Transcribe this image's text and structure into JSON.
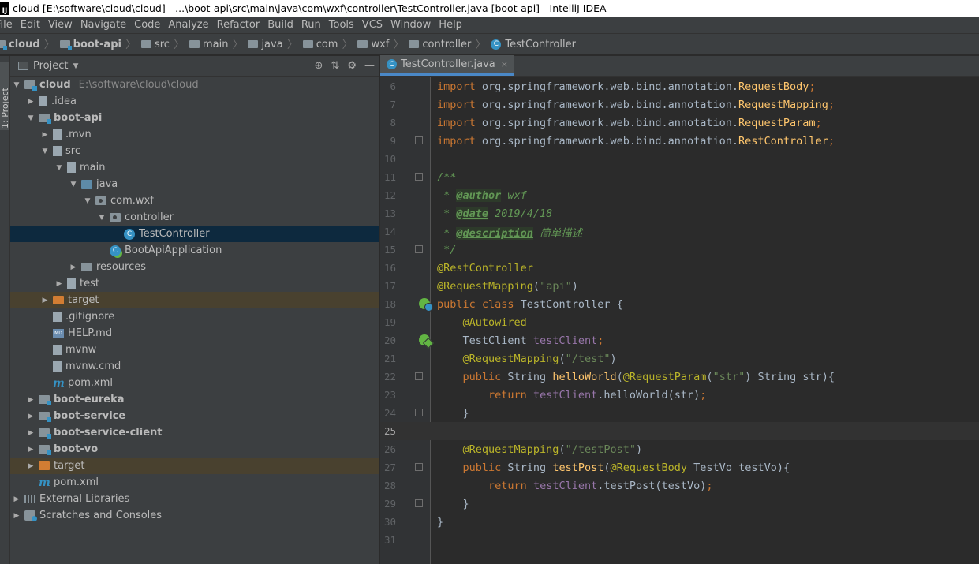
{
  "window": {
    "title": "cloud [E:\\software\\cloud\\cloud] - ...\\boot-api\\src\\main\\java\\com\\wxf\\controller\\TestController.java [boot-api] - IntelliJ IDEA",
    "app_icon": "IJ"
  },
  "menu": [
    "File",
    "Edit",
    "View",
    "Navigate",
    "Code",
    "Analyze",
    "Refactor",
    "Build",
    "Run",
    "Tools",
    "VCS",
    "Window",
    "Help"
  ],
  "breadcrumbs": [
    {
      "label": "cloud",
      "bold": true,
      "icon": "module-folder-icon"
    },
    {
      "label": "boot-api",
      "bold": true,
      "icon": "module-folder-icon"
    },
    {
      "label": "src",
      "icon": "folder-icon"
    },
    {
      "label": "main",
      "icon": "folder-icon"
    },
    {
      "label": "java",
      "icon": "source-folder-icon"
    },
    {
      "label": "com",
      "icon": "package-icon"
    },
    {
      "label": "wxf",
      "icon": "package-icon"
    },
    {
      "label": "controller",
      "icon": "package-icon"
    },
    {
      "label": "TestController",
      "icon": "class-icon"
    }
  ],
  "sidebar_tab": "1: Project",
  "project_panel": {
    "title": "Project",
    "tree": [
      {
        "label": "cloud",
        "path": "E:\\software\\cloud\\cloud",
        "depth": 0,
        "expanded": true,
        "bold": true,
        "icon": "module-folder-icon"
      },
      {
        "label": ".idea",
        "depth": 1,
        "expanded": false,
        "icon": "folder-icon"
      },
      {
        "label": "boot-api",
        "depth": 1,
        "expanded": true,
        "bold": true,
        "icon": "module-folder-icon"
      },
      {
        "label": ".mvn",
        "depth": 2,
        "expanded": false,
        "icon": "folder-icon"
      },
      {
        "label": "src",
        "depth": 2,
        "expanded": true,
        "icon": "folder-icon"
      },
      {
        "label": "main",
        "depth": 3,
        "expanded": true,
        "icon": "folder-icon"
      },
      {
        "label": "java",
        "depth": 4,
        "expanded": true,
        "icon": "source-folder-icon"
      },
      {
        "label": "com.wxf",
        "depth": 5,
        "expanded": true,
        "icon": "package-icon"
      },
      {
        "label": "controller",
        "depth": 6,
        "expanded": true,
        "icon": "package-icon"
      },
      {
        "label": "TestController",
        "depth": 7,
        "selected": true,
        "icon": "class-icon"
      },
      {
        "label": "BootApiApplication",
        "depth": 6,
        "icon": "spring-boot-class-icon"
      },
      {
        "label": "resources",
        "depth": 4,
        "expanded": false,
        "icon": "resources-folder-icon"
      },
      {
        "label": "test",
        "depth": 3,
        "expanded": false,
        "icon": "folder-icon"
      },
      {
        "label": "target",
        "depth": 2,
        "expanded": false,
        "excluded": true,
        "icon": "excluded-folder-icon"
      },
      {
        "label": ".gitignore",
        "depth": 2,
        "icon": "file-icon"
      },
      {
        "label": "HELP.md",
        "depth": 2,
        "icon": "markdown-file-icon"
      },
      {
        "label": "mvnw",
        "depth": 2,
        "icon": "file-icon"
      },
      {
        "label": "mvnw.cmd",
        "depth": 2,
        "icon": "file-icon"
      },
      {
        "label": "pom.xml",
        "depth": 2,
        "icon": "maven-icon"
      },
      {
        "label": "boot-eureka",
        "depth": 1,
        "expanded": false,
        "bold": true,
        "icon": "module-folder-icon"
      },
      {
        "label": "boot-service",
        "depth": 1,
        "expanded": false,
        "bold": true,
        "icon": "module-folder-icon"
      },
      {
        "label": "boot-service-client",
        "depth": 1,
        "expanded": false,
        "bold": true,
        "icon": "module-folder-icon"
      },
      {
        "label": "boot-vo",
        "depth": 1,
        "expanded": false,
        "bold": true,
        "icon": "module-folder-icon"
      },
      {
        "label": "target",
        "depth": 1,
        "expanded": false,
        "excluded": true,
        "icon": "excluded-folder-icon"
      },
      {
        "label": "pom.xml",
        "depth": 1,
        "icon": "maven-icon"
      },
      {
        "label": "External Libraries",
        "depth": 0,
        "expanded": false,
        "icon": "libraries-icon"
      },
      {
        "label": "Scratches and Consoles",
        "depth": 0,
        "expanded": false,
        "icon": "scratches-icon"
      }
    ]
  },
  "editor": {
    "tab": {
      "label": "TestController.java",
      "icon": "class-icon",
      "close": "×"
    },
    "current_line": 25,
    "lines": [
      {
        "n": 6,
        "tokens": [
          [
            "kw",
            "import"
          ],
          [
            "p",
            " org.springframework.web.bind.annotation."
          ],
          [
            "cls",
            "RequestBody"
          ],
          [
            "kw",
            ";"
          ]
        ]
      },
      {
        "n": 7,
        "tokens": [
          [
            "kw",
            "import"
          ],
          [
            "p",
            " org.springframework.web.bind.annotation."
          ],
          [
            "cls",
            "RequestMapping"
          ],
          [
            "kw",
            ";"
          ]
        ]
      },
      {
        "n": 8,
        "tokens": [
          [
            "kw",
            "import"
          ],
          [
            "p",
            " org.springframework.web.bind.annotation."
          ],
          [
            "cls",
            "RequestParam"
          ],
          [
            "kw",
            ";"
          ]
        ]
      },
      {
        "n": 9,
        "fold": true,
        "tokens": [
          [
            "kw",
            "import"
          ],
          [
            "p",
            " org.springframework.web.bind.annotation."
          ],
          [
            "cls",
            "RestController"
          ],
          [
            "kw",
            ";"
          ]
        ]
      },
      {
        "n": 10,
        "tokens": []
      },
      {
        "n": 11,
        "fold": true,
        "tokens": [
          [
            "doc",
            "/**"
          ]
        ]
      },
      {
        "n": 12,
        "tokens": [
          [
            "doc",
            " * "
          ],
          [
            "doctag",
            "@author"
          ],
          [
            "doc",
            " wxf"
          ]
        ]
      },
      {
        "n": 13,
        "tokens": [
          [
            "doc",
            " * "
          ],
          [
            "doctag",
            "@date"
          ],
          [
            "doc",
            " 2019/4/18"
          ]
        ]
      },
      {
        "n": 14,
        "tokens": [
          [
            "doc",
            " * "
          ],
          [
            "doctag",
            "@description"
          ],
          [
            "doc",
            " 简单描述"
          ]
        ]
      },
      {
        "n": 15,
        "fold": true,
        "tokens": [
          [
            "doc",
            " */"
          ]
        ]
      },
      {
        "n": 16,
        "tokens": [
          [
            "an",
            "@RestController"
          ]
        ]
      },
      {
        "n": 17,
        "tokens": [
          [
            "an",
            "@RequestMapping"
          ],
          [
            "p",
            "("
          ],
          [
            "str",
            "\"api\""
          ],
          [
            "p",
            ")"
          ]
        ]
      },
      {
        "n": 18,
        "gutter": "spring-bean-class-icon",
        "tokens": [
          [
            "kw",
            "public class "
          ],
          [
            "p",
            "TestController {"
          ]
        ]
      },
      {
        "n": 19,
        "tokens": [
          [
            "p",
            "    "
          ],
          [
            "an",
            "@Autowired"
          ]
        ]
      },
      {
        "n": 20,
        "gutter": "spring-autowired-icon",
        "tokens": [
          [
            "p",
            "    TestClient "
          ],
          [
            "fld",
            "testClient"
          ],
          [
            "kw",
            ";"
          ]
        ]
      },
      {
        "n": 21,
        "tokens": [
          [
            "p",
            "    "
          ],
          [
            "an",
            "@RequestMapping"
          ],
          [
            "p",
            "("
          ],
          [
            "str",
            "\"/test\""
          ],
          [
            "p",
            ")"
          ]
        ]
      },
      {
        "n": 22,
        "fold": true,
        "tokens": [
          [
            "p",
            "    "
          ],
          [
            "kw",
            "public "
          ],
          [
            "p",
            "String "
          ],
          [
            "fn",
            "helloWorld"
          ],
          [
            "p",
            "("
          ],
          [
            "an",
            "@RequestParam"
          ],
          [
            "p",
            "("
          ],
          [
            "str",
            "\"str\""
          ],
          [
            "p",
            ") String str){"
          ]
        ]
      },
      {
        "n": 23,
        "tokens": [
          [
            "p",
            "        "
          ],
          [
            "kw",
            "return "
          ],
          [
            "fld",
            "testClient"
          ],
          [
            "p",
            ".helloWorld(str)"
          ],
          [
            "kw",
            ";"
          ]
        ]
      },
      {
        "n": 24,
        "fold": true,
        "tokens": [
          [
            "p",
            "    }"
          ]
        ]
      },
      {
        "n": 25,
        "tokens": []
      },
      {
        "n": 26,
        "tokens": [
          [
            "p",
            "    "
          ],
          [
            "an",
            "@RequestMapping"
          ],
          [
            "p",
            "("
          ],
          [
            "str",
            "\"/testPost\""
          ],
          [
            "p",
            ")"
          ]
        ]
      },
      {
        "n": 27,
        "fold": true,
        "tokens": [
          [
            "p",
            "    "
          ],
          [
            "kw",
            "public "
          ],
          [
            "p",
            "String "
          ],
          [
            "fn",
            "testPost"
          ],
          [
            "p",
            "("
          ],
          [
            "an",
            "@RequestBody"
          ],
          [
            "p",
            " TestVo testVo){"
          ]
        ]
      },
      {
        "n": 28,
        "tokens": [
          [
            "p",
            "        "
          ],
          [
            "kw",
            "return "
          ],
          [
            "fld",
            "testClient"
          ],
          [
            "p",
            ".testPost(testVo)"
          ],
          [
            "kw",
            ";"
          ]
        ]
      },
      {
        "n": 29,
        "fold": true,
        "tokens": [
          [
            "p",
            "    }"
          ]
        ]
      },
      {
        "n": 30,
        "tokens": [
          [
            "p",
            "}"
          ]
        ]
      },
      {
        "n": 31,
        "tokens": []
      }
    ]
  },
  "colors": {
    "editor_bg": "#2b2b2b",
    "panel_bg": "#3c3f41",
    "selection": "#0d293e",
    "keyword": "#cc7832",
    "annotation": "#bbb529",
    "string": "#6a8759",
    "field": "#9876aa",
    "method": "#ffc66d",
    "doc": "#629755"
  }
}
